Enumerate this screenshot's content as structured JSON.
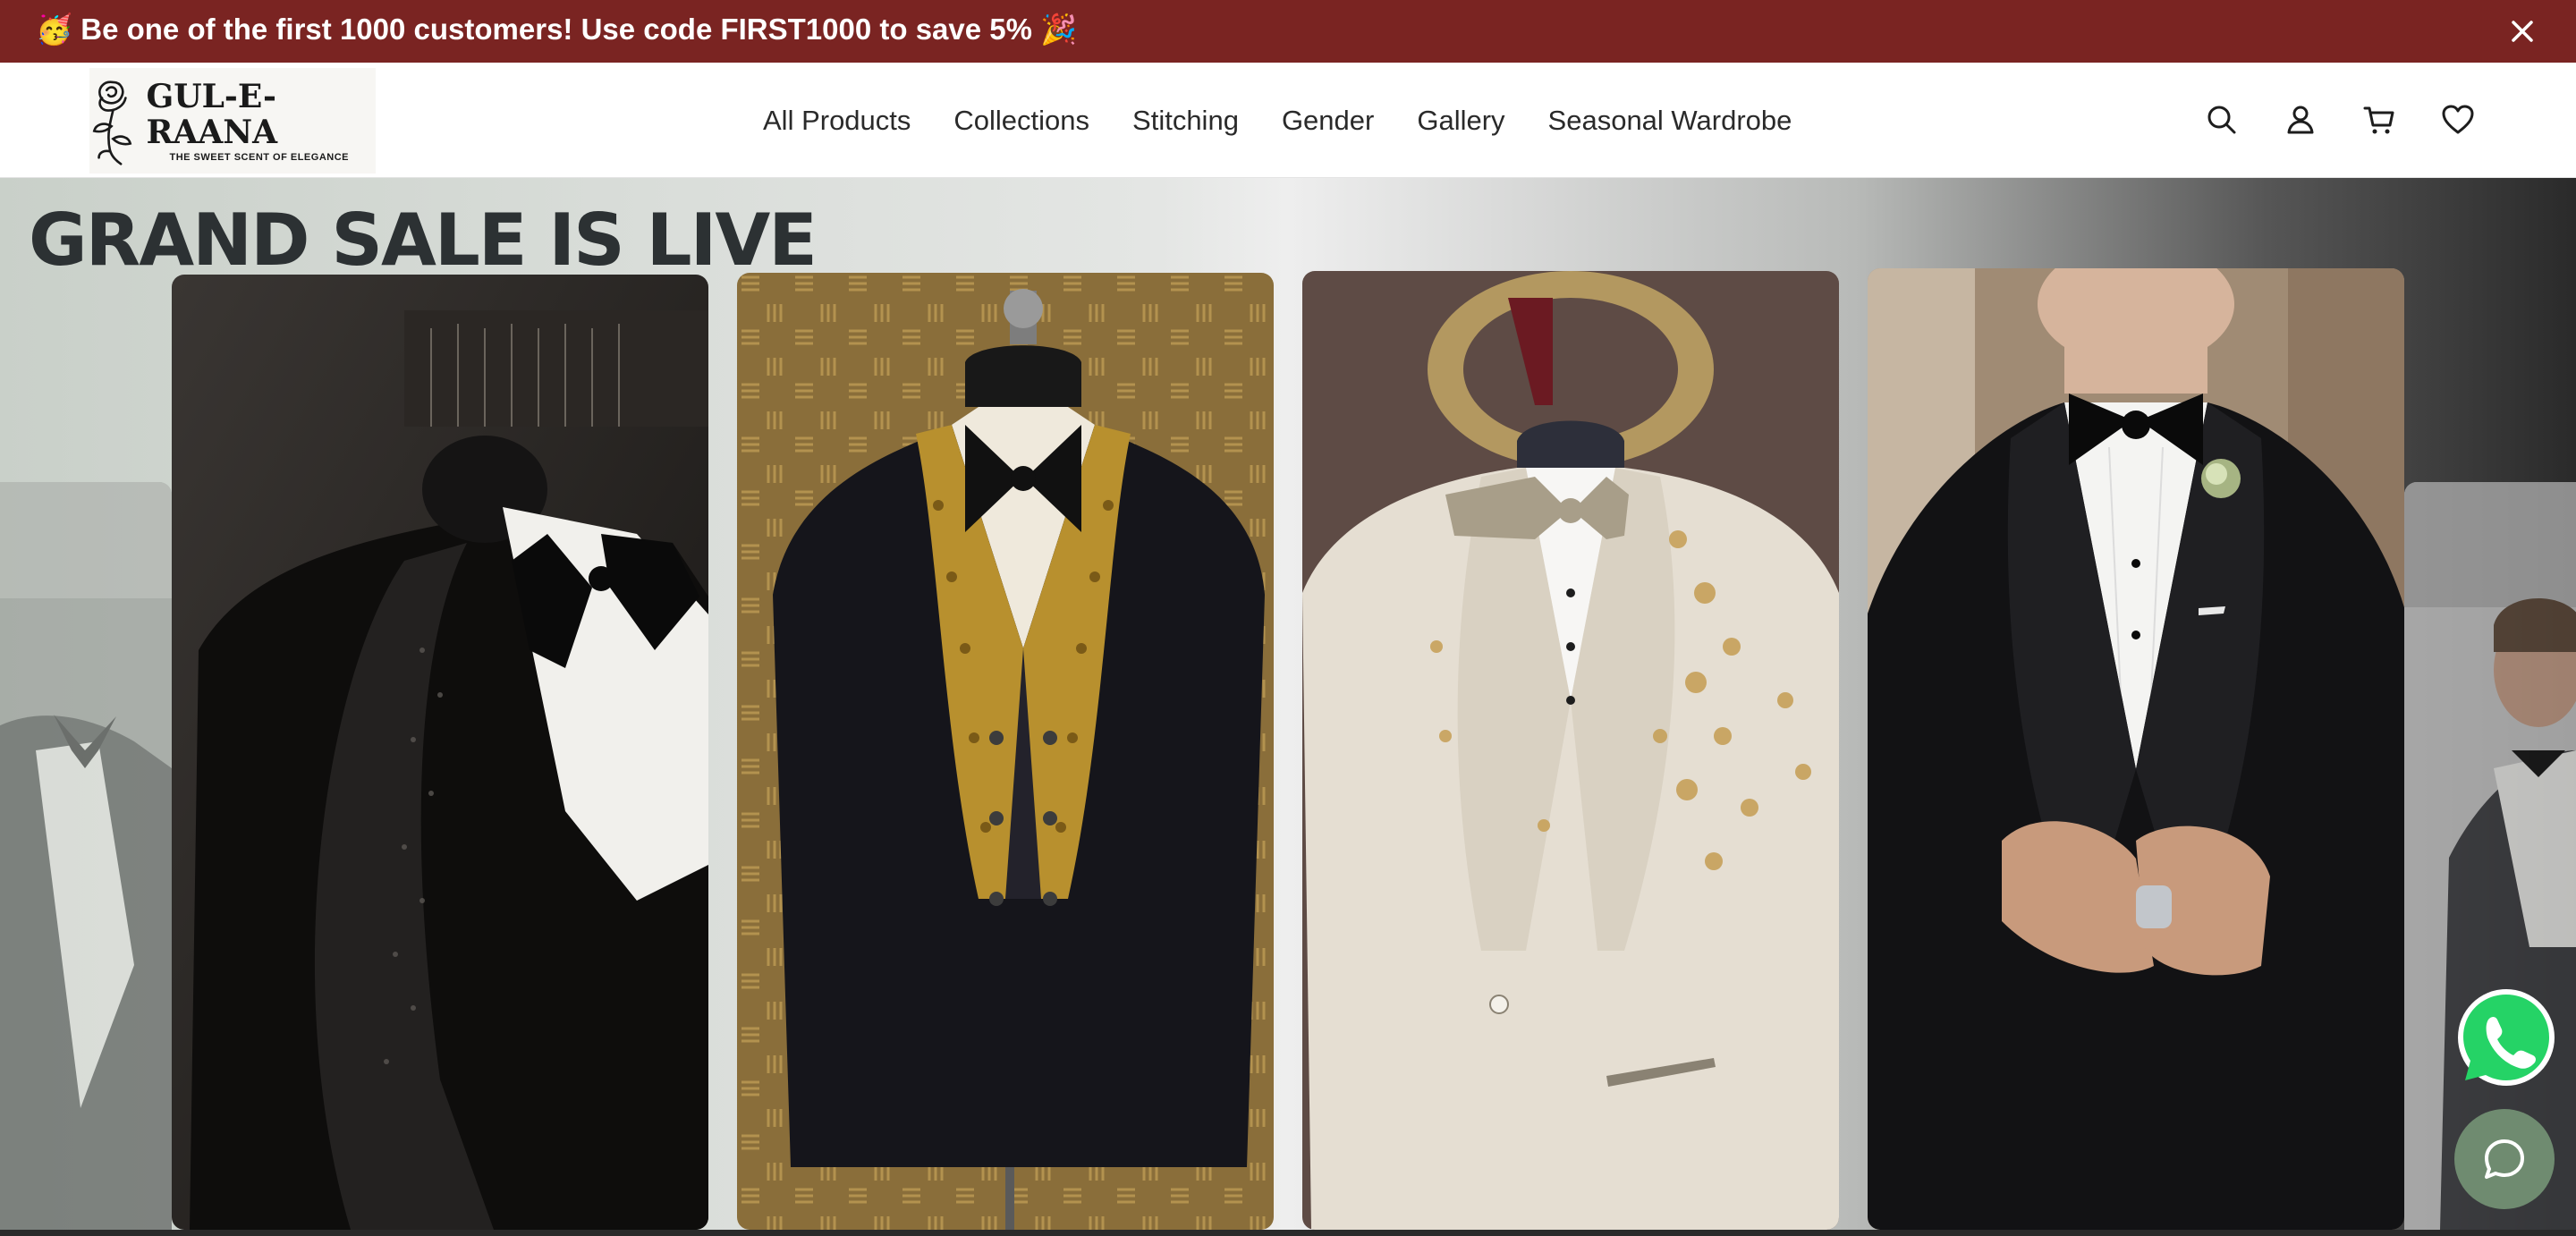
{
  "announcement": {
    "text": "🥳 Be one of the first 1000 customers! Use code FIRST1000 to save 5% 🎉",
    "close_icon": "close-icon",
    "background": "#7a2422"
  },
  "brand": {
    "name": "GUL-E-RAANA",
    "tagline": "THE SWEET SCENT OF ELEGANCE",
    "logo_icon": "rose-icon"
  },
  "nav": {
    "items": [
      {
        "label": "All Products"
      },
      {
        "label": "Collections"
      },
      {
        "label": "Stitching"
      },
      {
        "label": "Gender"
      },
      {
        "label": "Gallery"
      },
      {
        "label": "Seasonal Wardrobe"
      }
    ]
  },
  "header_icons": [
    "search-icon",
    "account-icon",
    "cart-icon",
    "wishlist-heart-icon"
  ],
  "hero": {
    "title": "GRAND SALE IS LIVE",
    "slides": [
      {
        "subject": "black embellished tuxedo with bow tie on mannequin"
      },
      {
        "subject": "black velvet sherwani suit with gold embroidered lapel"
      },
      {
        "subject": "ivory embroidered suit with bow tie on mannequin"
      },
      {
        "subject": "black double-breasted tuxedo with boutonniere"
      }
    ]
  },
  "floating": {
    "whatsapp_icon": "whatsapp-icon",
    "chat_icon": "chat-icon",
    "chat_color": "#6f8b70",
    "whatsapp_color": "#25d366"
  }
}
